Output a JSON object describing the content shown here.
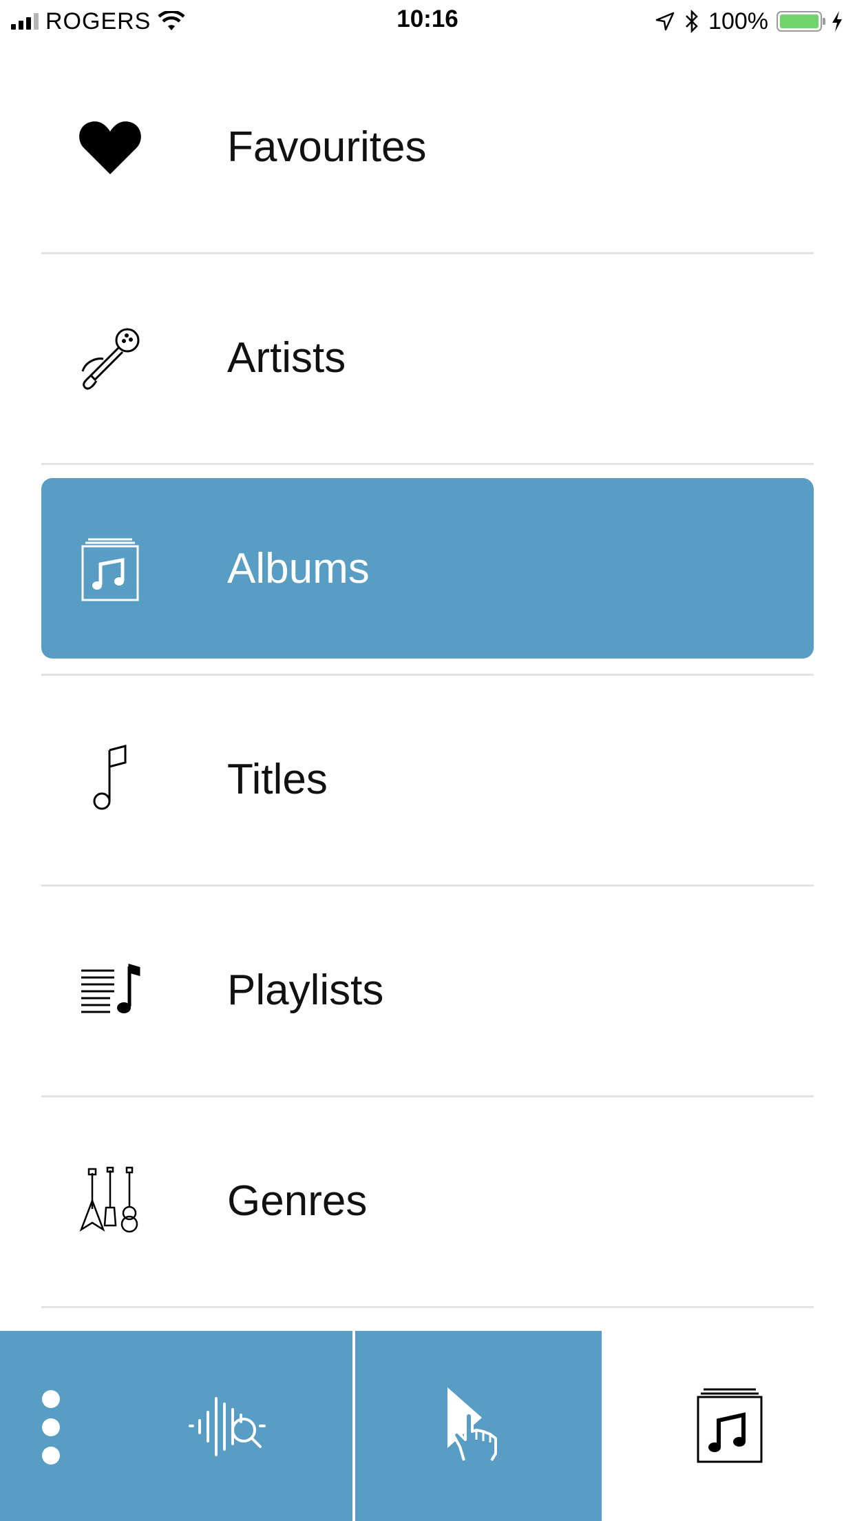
{
  "status_bar": {
    "carrier": "ROGERS",
    "time": "10:16",
    "battery_percent": "100%",
    "battery_level": 1.0,
    "battery_color": "#6fd56a",
    "signal_bars": 3,
    "icons": [
      "signal-icon",
      "wifi-icon",
      "location-arrow-icon",
      "bluetooth-icon",
      "battery-icon",
      "charging-icon"
    ]
  },
  "menu": {
    "accent_color": "#579dc4",
    "selected": "Albums",
    "items": [
      {
        "label": "Favourites",
        "icon": "heart-icon"
      },
      {
        "label": "Artists",
        "icon": "microphone-icon"
      },
      {
        "label": "Albums",
        "icon": "album-icon"
      },
      {
        "label": "Titles",
        "icon": "music-note-icon"
      },
      {
        "label": "Playlists",
        "icon": "playlist-icon"
      },
      {
        "label": "Genres",
        "icon": "guitars-icon"
      }
    ]
  },
  "tab_bar": {
    "tabs": [
      {
        "icon": "more-icon"
      },
      {
        "icon": "sound-search-icon"
      },
      {
        "icon": "touch-play-icon"
      },
      {
        "icon": "album-icon",
        "active": true
      }
    ]
  }
}
